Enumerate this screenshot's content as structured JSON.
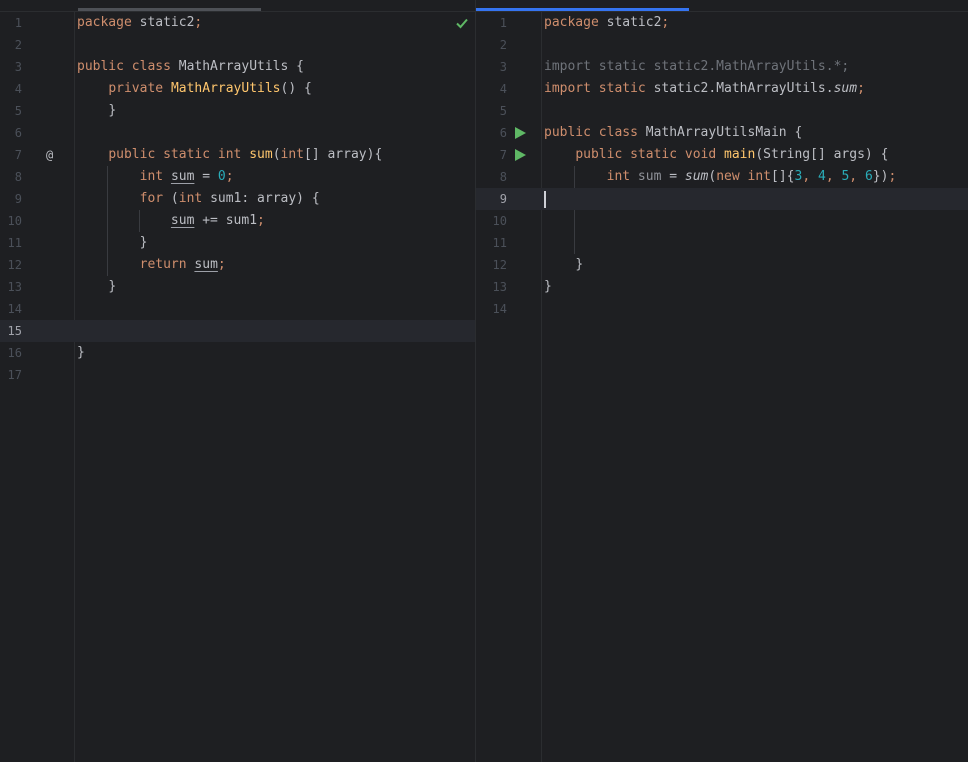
{
  "colors": {
    "background": "#1e1f22",
    "keyword": "#cf8e6d",
    "method": "#56a8f5",
    "number": "#2aacb8",
    "run": "#5fb865",
    "check": "#5fb865"
  },
  "left_editor": {
    "line_numbers": [
      "1",
      "2",
      "3",
      "4",
      "5",
      "6",
      "7",
      "8",
      "9",
      "10",
      "11",
      "12",
      "13",
      "14",
      "15",
      "16",
      "17"
    ],
    "current_line": "15",
    "gutter_marker_line7": "@",
    "status_icon": "checkmark-icon",
    "lines": {
      "l1": {
        "kw": "package",
        "rest": " static2",
        "semi": ";"
      },
      "l3": {
        "kw": "public class",
        "rest": " MathArrayUtils {"
      },
      "l4": {
        "kw": "private",
        "ctor": "MathArrayUtils",
        "rest": "() {"
      },
      "l5": {
        "rest": "}"
      },
      "l7": {
        "kw1": "public static int ",
        "fn": "sum",
        "p1": "(",
        "kw2": "int",
        "p2": "[] array){"
      },
      "l8": {
        "kw": "int",
        "var": "sum",
        "op": " = ",
        "num": "0",
        "semi": ";"
      },
      "l9": {
        "kw1": "for",
        "p1": " (",
        "kw2": "int",
        "p2": " sum1: array) {"
      },
      "l10": {
        "var": "sum",
        "rest": " += sum1",
        "semi": ";"
      },
      "l11": {
        "rest": "}"
      },
      "l12": {
        "kw": "return",
        "var": "sum",
        "semi": ";"
      },
      "l13": {
        "rest": "}"
      },
      "l16": {
        "rest": "}"
      }
    }
  },
  "right_editor": {
    "line_numbers": [
      "1",
      "2",
      "3",
      "4",
      "5",
      "6",
      "7",
      "8",
      "9",
      "10",
      "11",
      "12",
      "13",
      "14"
    ],
    "current_line": "9",
    "run_icons": [
      "run-class-icon",
      "run-main-icon"
    ],
    "lines": {
      "l1": {
        "kw": "package",
        "rest": " static2",
        "semi": ";"
      },
      "l3": {
        "text": "import static static2.MathArrayUtils.*;"
      },
      "l4": {
        "kw": "import static",
        "rest": " static2.MathArrayUtils.",
        "it": "sum",
        "semi": ";"
      },
      "l6": {
        "kw": "public class",
        "rest": " MathArrayUtilsMain {"
      },
      "l7": {
        "kw": "public static void ",
        "fn": "main",
        "rest": "(String[] args) {"
      },
      "l8": {
        "kw1": "int",
        "var": " sum",
        "op": " = ",
        "it": "sum",
        "p1": "(",
        "kw2": "new int",
        "p2": "[]{",
        "n1": "3",
        "c1": ", ",
        "n2": "4",
        "c2": ", ",
        "n3": "5",
        "c3": ", ",
        "n4": "6",
        "p3": "})",
        "semi": ";"
      },
      "l12": {
        "rest": "}"
      },
      "l13": {
        "rest": "}"
      }
    }
  }
}
